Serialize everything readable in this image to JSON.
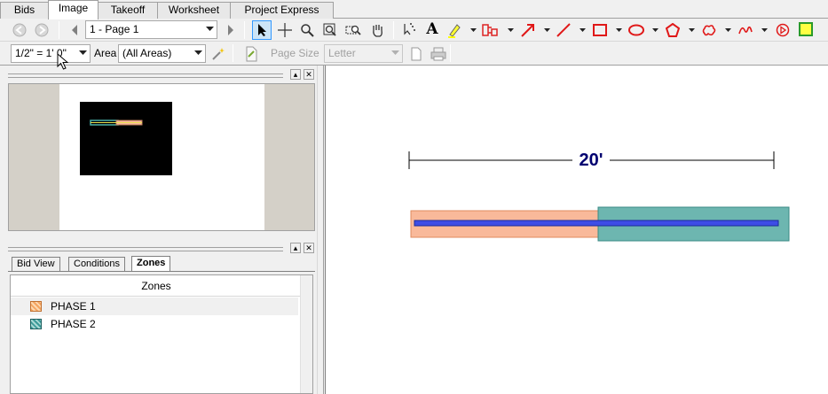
{
  "tabs": [
    {
      "label": "Bids",
      "active": false
    },
    {
      "label": "Image",
      "active": true
    },
    {
      "label": "Takeoff",
      "active": false
    },
    {
      "label": "Worksheet",
      "active": false
    },
    {
      "label": "Project Express",
      "active": false
    }
  ],
  "toolbar1": {
    "page_select": "1 - Page 1",
    "tools": [
      "back-icon",
      "forward-icon",
      "prev-page-icon",
      "next-page-icon",
      "select-arrow-icon",
      "crosshair-icon",
      "zoom-icon",
      "zoom-window-icon",
      "zoom-area-icon",
      "pan-hand-icon",
      "magic-select-icon",
      "text-icon",
      "highlighter-icon",
      "stamp-icon",
      "arrow-tool-icon",
      "line-tool-icon",
      "rectangle-tool-icon",
      "ellipse-tool-icon",
      "polygon-tool-icon",
      "cloud-tool-icon",
      "freehand-tool-icon",
      "record-icon",
      "note-icon"
    ]
  },
  "toolbar2": {
    "scale_value": "1/2\" = 1' 0\"",
    "area_label": "Area",
    "area_value": "(All Areas)",
    "page_size_label": "Page Size",
    "paper_value": "Letter"
  },
  "subtabs": [
    {
      "label": "Bid View",
      "active": false
    },
    {
      "label": "Conditions",
      "active": false
    },
    {
      "label": "Zones",
      "active": true
    }
  ],
  "zones": {
    "header": "Zones",
    "items": [
      {
        "name": "PHASE 1",
        "color": "#f4a460",
        "selected": true
      },
      {
        "name": "PHASE 2",
        "color": "#3a9a98",
        "selected": false
      }
    ]
  },
  "drawing": {
    "dimension_label": "20'",
    "phase1_fill": "#f9b99a",
    "phase2_fill": "#6db6b0",
    "line_color": "#3e4de6"
  }
}
